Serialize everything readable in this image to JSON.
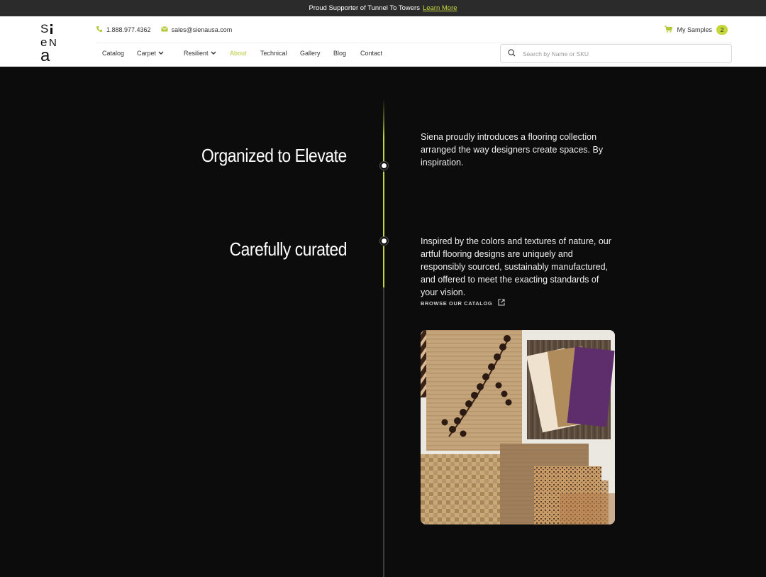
{
  "banner": {
    "text": "Proud Supporter of Tunnel To Towers",
    "link": "Learn More"
  },
  "header": {
    "logo_text": "Siena",
    "phone": "1.888.977.4362",
    "email": "sales@sienausa.com",
    "samples_label": "My Samples",
    "samples_count": "2",
    "nav": [
      {
        "label": "Catalog"
      },
      {
        "label": "Carpet"
      },
      {
        "label": "Resilient"
      },
      {
        "label": "About"
      },
      {
        "label": "Technical"
      },
      {
        "label": "Gallery"
      },
      {
        "label": "Blog"
      },
      {
        "label": "Contact"
      }
    ],
    "search_placeholder": "Search by Name or SKU"
  },
  "sections": [
    {
      "heading": "Organized to Elevate",
      "body": "Siena proudly introduces a flooring collection arranged the way designers create spaces. By inspiration."
    },
    {
      "heading": "Carefully curated",
      "body": "Inspired by the colors and textures of nature, our artful flooring designs are uniquely and responsibly sourced, sustainably manufactured, and offered to meet the exacting standards of your vision."
    }
  ],
  "cta": {
    "browse_label": "BROWSE OUR CATALOG"
  },
  "colors": {
    "accent": "#c5d73a",
    "background": "#0c0c0c",
    "topbar": "#2b2b2b"
  }
}
